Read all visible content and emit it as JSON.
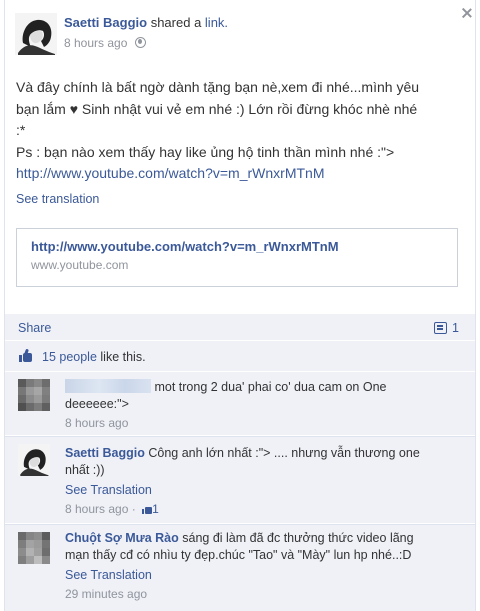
{
  "post": {
    "author": "Saetti Baggio",
    "action": "shared a",
    "action_link": "link.",
    "time": "8 hours ago",
    "text_line1": "Và đây chính là bất ngờ dành tặng bạn nè,xem đi nhé...mình yêu",
    "text_line2": "bạn lắm ♥ Sinh nhật vui vẻ em nhé :) Lớn rồi đừng khóc nhè nhé",
    "text_line3": ":*",
    "text_line4": "Ps : bạn nào xem thấy hay like ủng hộ tinh thần mình nhé :\">",
    "text_url": "http://www.youtube.com/watch?v=m_rWnxrMTnM",
    "see_translation": "See translation"
  },
  "link_card": {
    "url": "http://www.youtube.com/watch?v=m_rWnxrMTnM",
    "domain": "www.youtube.com"
  },
  "actions": {
    "share": "Share",
    "comment_count": "1"
  },
  "likes": {
    "people": "15 people",
    "suffix": " like this."
  },
  "comments": [
    {
      "name": "",
      "text": " mot trong 2 dua' phai co' dua cam on One",
      "text2": "deeeeee:\">",
      "time": "8 hours ago"
    },
    {
      "name": "Saetti Baggio",
      "text": " Công anh lớn nhất :\"> .... nhưng vẫn thương one",
      "text2": "nhất :))",
      "see_translation": "See Translation",
      "time": "8 hours ago",
      "likes": "1"
    },
    {
      "name": "Chuột Sợ Mưa Rào",
      "text": " sáng đi làm đã đc thưởng thức video lãng",
      "text2": "mạn thấy cđ có nhìu ty đẹp.chúc \"Tao\" và \"Mày\" lun hp nhé..:D",
      "see_translation": "See Translation",
      "time": "29 minutes ago"
    }
  ],
  "colors": {
    "link_blue": "#3b5998",
    "panel_bg": "#eff1f7",
    "meta_gray": "#90949c"
  },
  "icons": [
    "globe-icon",
    "close-icon",
    "comment-icon",
    "thumbs-up-icon"
  ]
}
